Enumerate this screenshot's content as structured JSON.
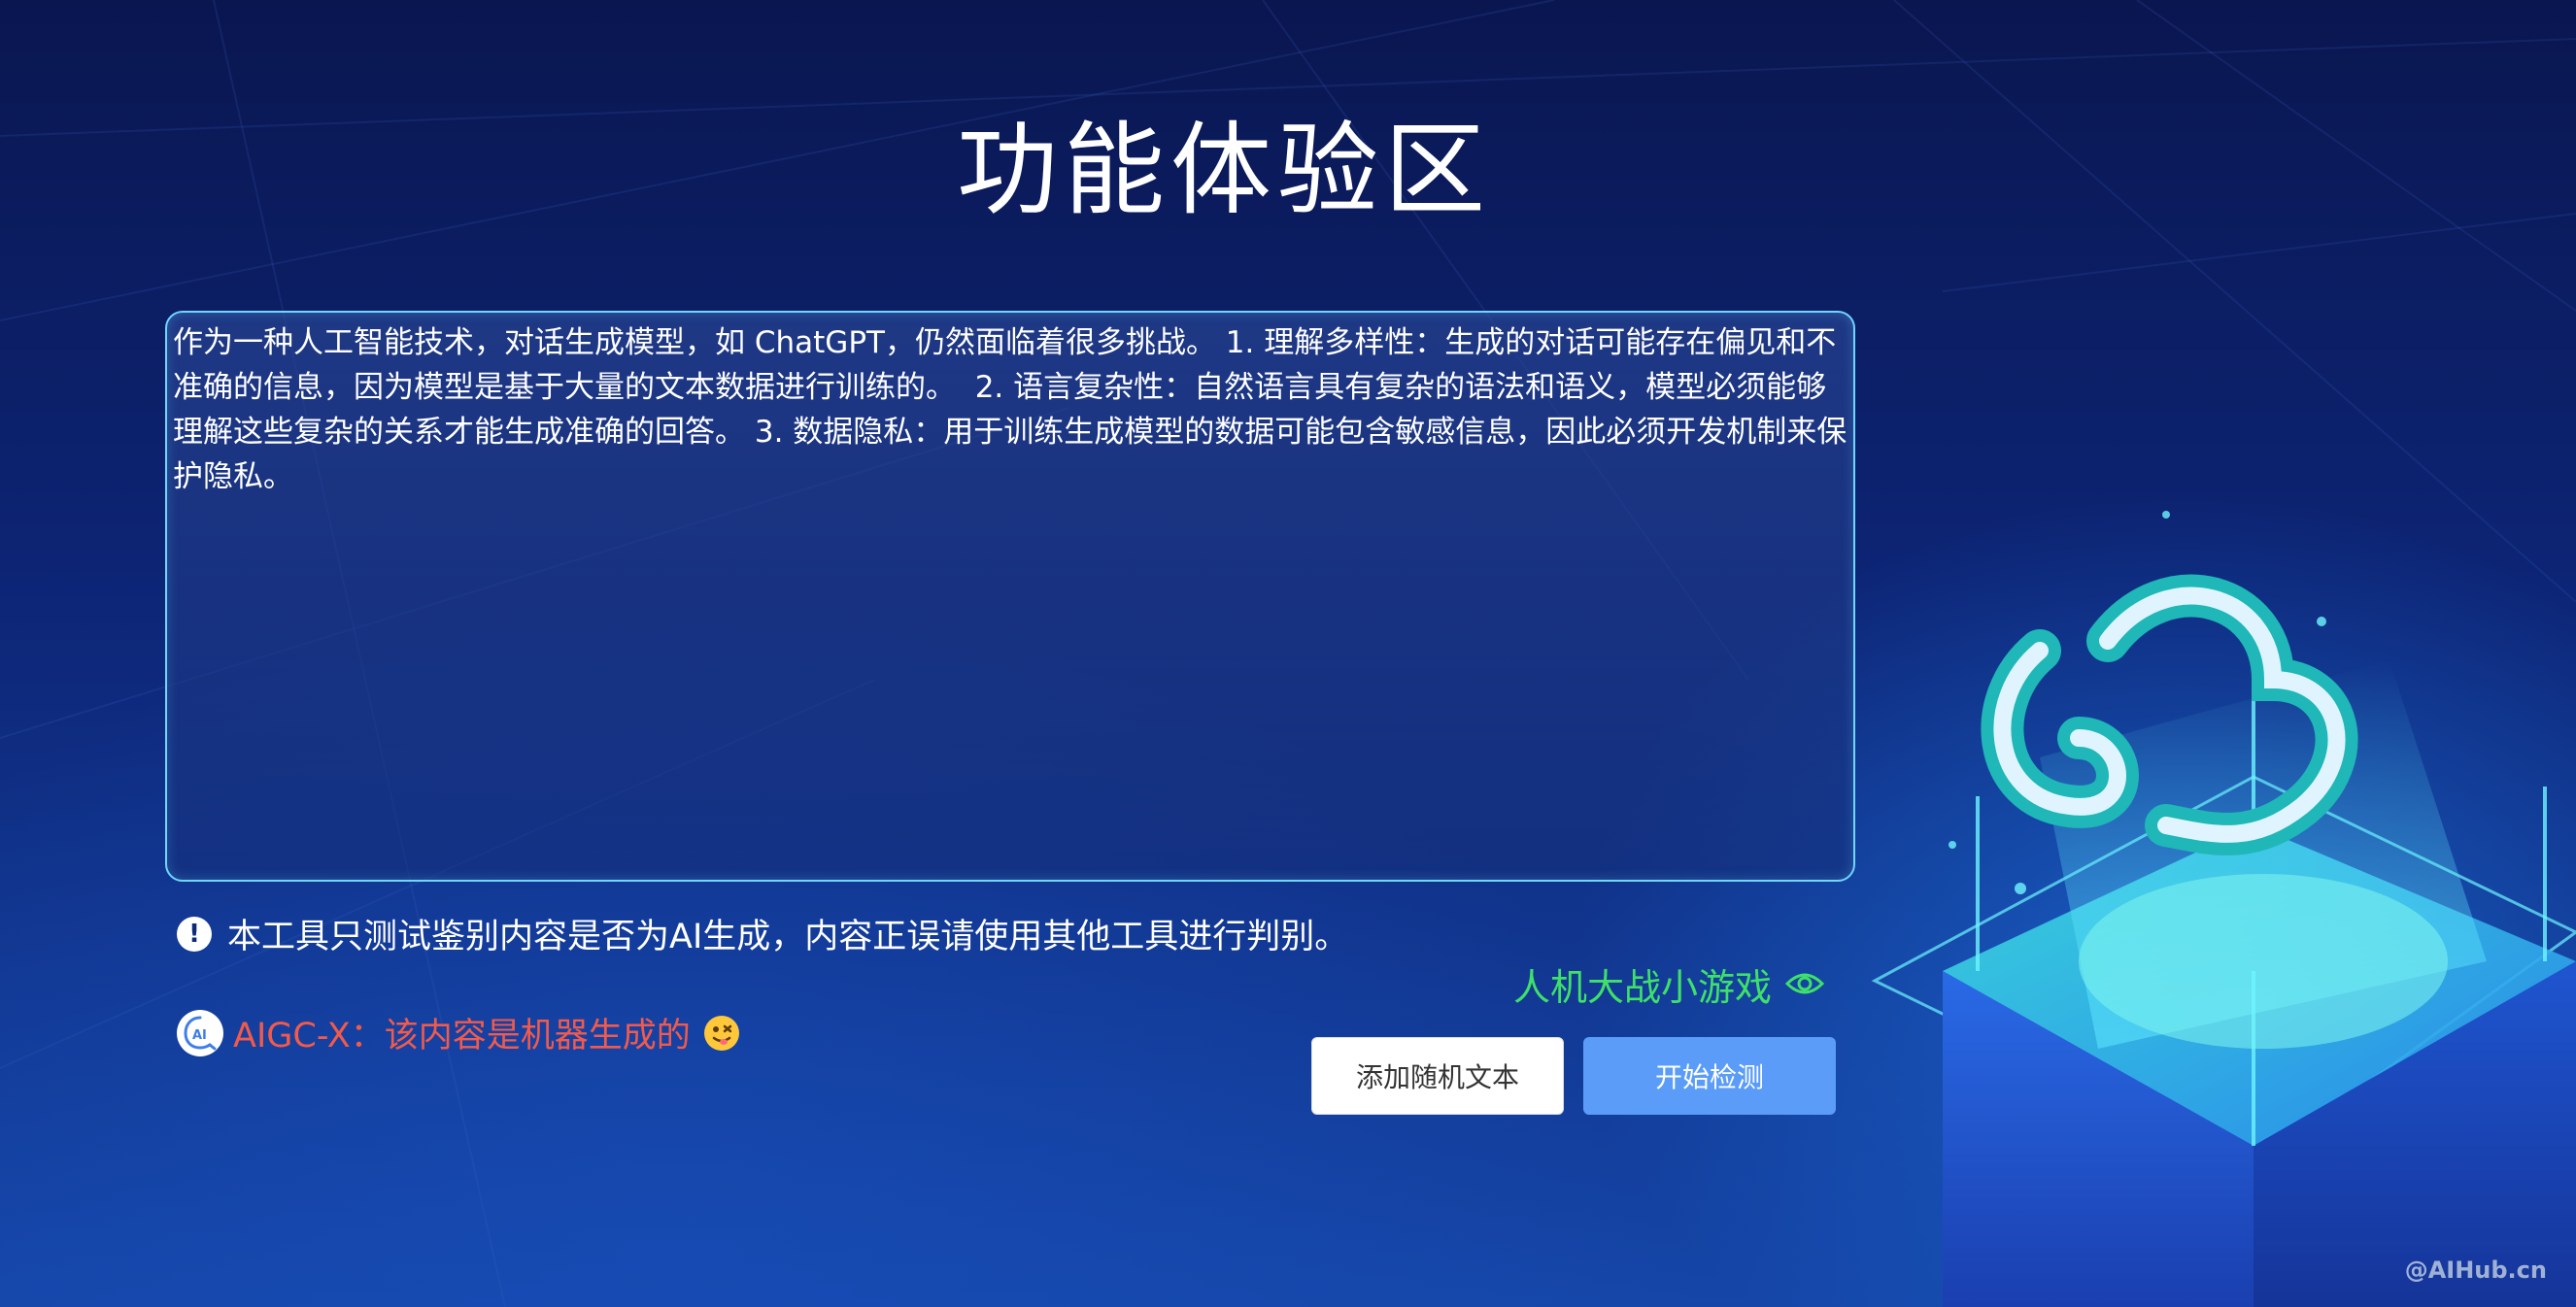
{
  "page": {
    "title": "功能体验区"
  },
  "detector": {
    "input_text": "作为一种人工智能技术，对话生成模型，如 ChatGPT，仍然面临着很多挑战。 1. 理解多样性：生成的对话可能存在偏见和不准确的信息，因为模型是基于大量的文本数据进行训练的。  2. 语言复杂性：自然语言具有复杂的语法和语义，模型必须能够理解这些复杂的关系才能生成准确的回答。 3. 数据隐私：用于训练生成模型的数据可能包含敏感信息，因此必须开发机制来保护隐私。",
    "notice": "本工具只测试鉴别内容是否为AI生成，内容正误请使用其他工具进行判别。",
    "result": "AIGC-X：该内容是机器生成的",
    "result_color": "#f25a4b"
  },
  "game": {
    "label": "人机大战小游戏",
    "color": "#3fe06a"
  },
  "buttons": {
    "random_text": "添加随机文本",
    "start_detect": "开始检测"
  },
  "brand": {
    "icon_letters": "AI"
  },
  "watermark": "@AIHub.cn",
  "icons": [
    "exclamation-icon",
    "aigc-logo-icon",
    "dizzy-face-emoji-icon",
    "eye-icon",
    "cloud-illustration"
  ]
}
